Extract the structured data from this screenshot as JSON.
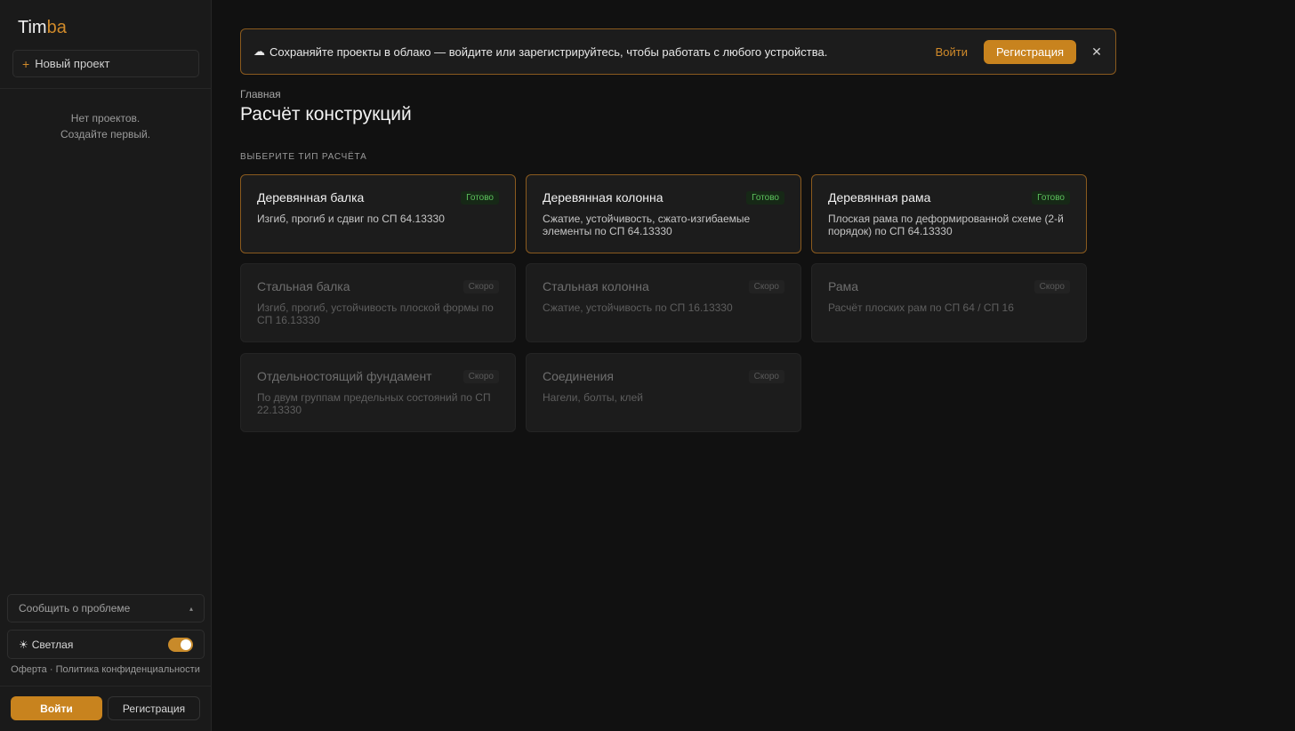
{
  "sidebar": {
    "logo_main": "Tim",
    "logo_accent": "ba",
    "new_project_icon": "+",
    "new_project_label": "Новый проект",
    "empty_line1": "Нет проектов.",
    "empty_line2": "Создайте первый.",
    "report_label": "Сообщить о проблеме",
    "report_chevron": "▴",
    "theme_icon": "☀",
    "theme_label": "Светлая",
    "legal": "Оферта · Политика конфиденциальности",
    "login_label": "Войти",
    "register_label": "Регистрация"
  },
  "banner": {
    "icon": "☁",
    "message": "Сохраняйте проекты в облако — войдите или зарегистрируйтесь, чтобы работать с любого устройства.",
    "login_label": "Войти",
    "register_label": "Регистрация",
    "close_icon": "✕"
  },
  "main": {
    "breadcrumb": "Главная",
    "title": "Расчёт конструкций",
    "section_label": "ВЫБЕРИТЕ ТИП РАСЧЁТА",
    "cards": [
      {
        "title": "Деревянная балка",
        "badge": "Готово",
        "desc": "Изгиб, прогиб и сдвиг по СП 64.13330"
      },
      {
        "title": "Деревянная колонна",
        "badge": "Готово",
        "desc": "Сжатие, устойчивость, сжато-изгибаемые элементы по СП 64.13330"
      },
      {
        "title": "Деревянная рама",
        "badge": "Готово",
        "desc": "Плоская рама по деформированной схеме (2-й порядок) по СП 64.13330"
      },
      {
        "title": "Стальная балка",
        "badge": "Скоро",
        "desc": "Изгиб, прогиб, устойчивость плоской формы по СП 16.13330"
      },
      {
        "title": "Стальная колонна",
        "badge": "Скоро",
        "desc": "Сжатие, устойчивость по СП 16.13330"
      },
      {
        "title": "Рама",
        "badge": "Скоро",
        "desc": "Расчёт плоских рам по СП 64 / СП 16"
      },
      {
        "title": "Отдельностоящий фундамент",
        "badge": "Скоро",
        "desc": "По двум группам предельных состояний по СП 22.13330"
      },
      {
        "title": "Соединения",
        "badge": "Скоро",
        "desc": "Нагели, болты, клей"
      }
    ]
  }
}
